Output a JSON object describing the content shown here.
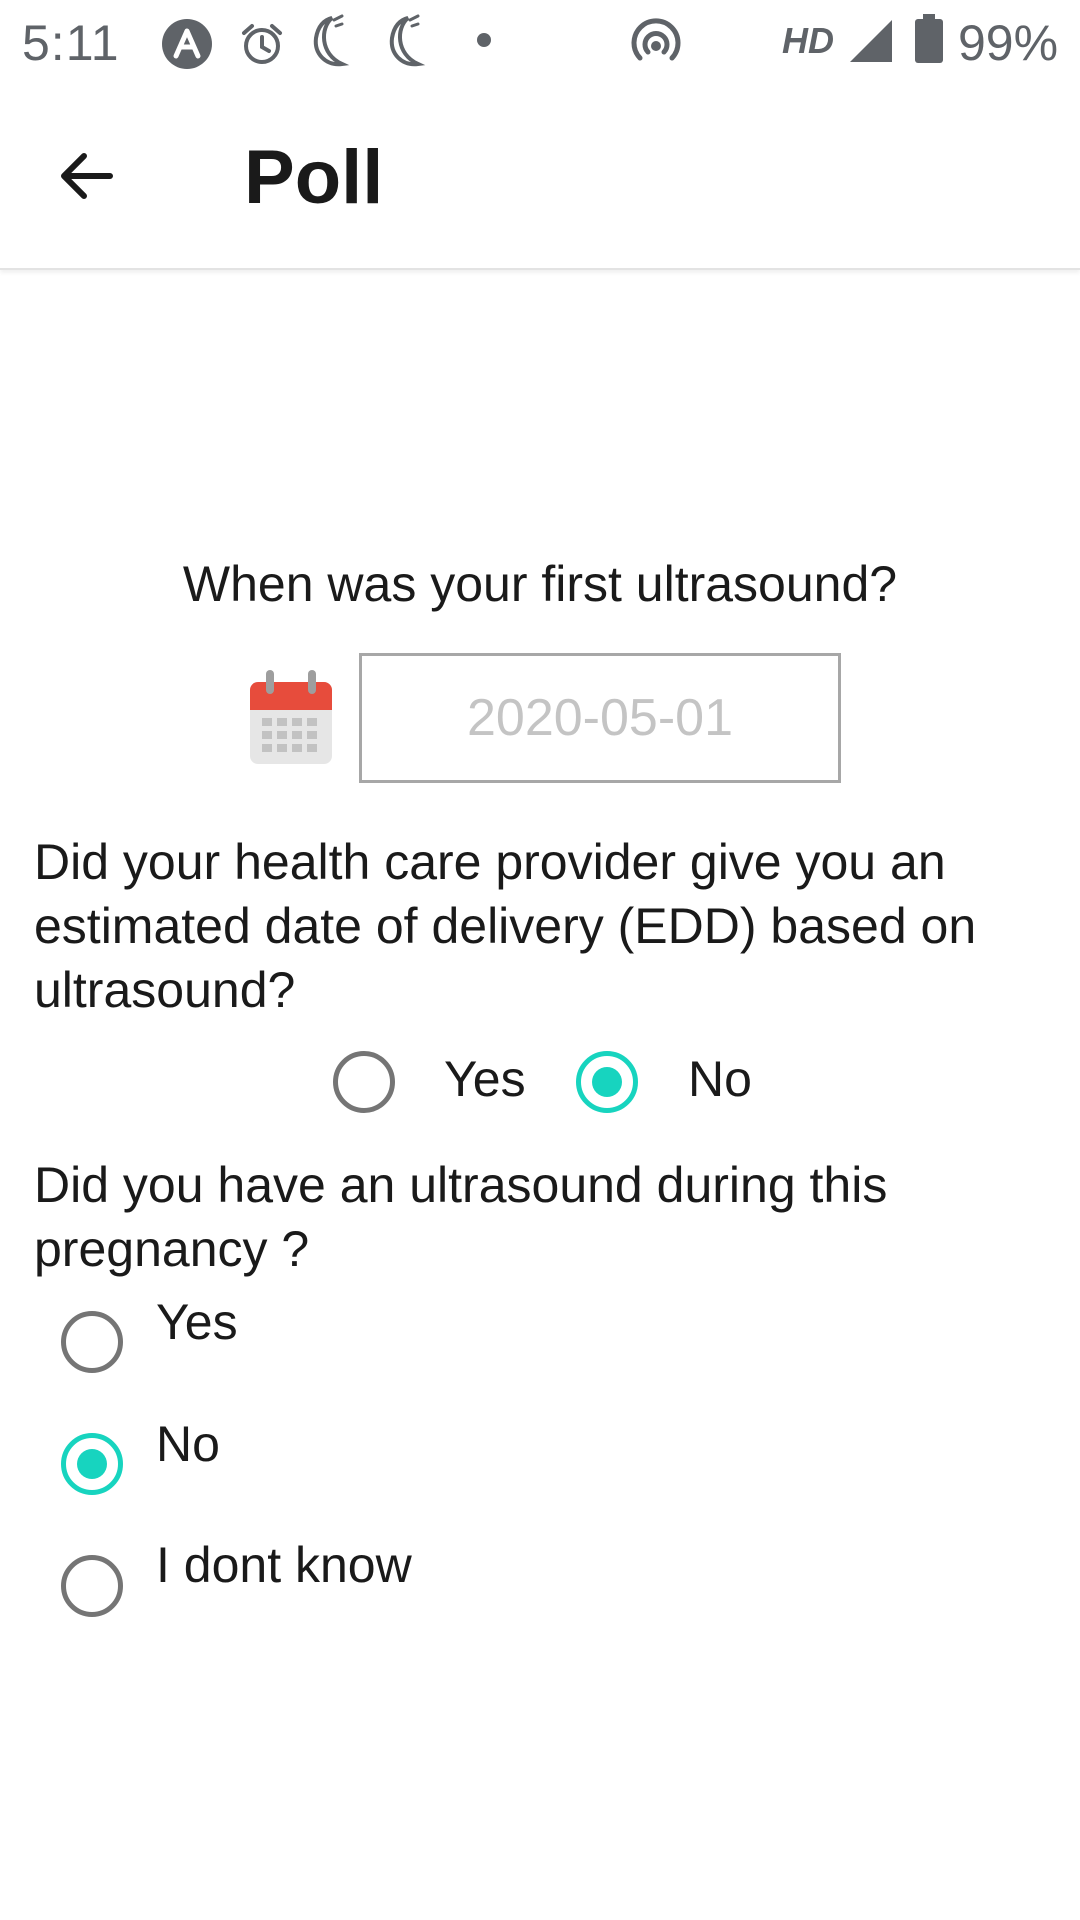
{
  "status_bar": {
    "time": "5:11",
    "network_type": "HD",
    "battery": "99%"
  },
  "app_bar": {
    "title": "Poll"
  },
  "question1": {
    "text": "When was your first ultrasound?",
    "date_placeholder": "2020-05-01"
  },
  "question2": {
    "text": " Did your health care provider give you an estimated date of delivery (EDD) based on ultrasound?",
    "options": [
      "Yes",
      "No"
    ],
    "selected": "No"
  },
  "question3": {
    "text": "Did you have an ultrasound during this pregnancy ?",
    "options": [
      "Yes",
      "No",
      "I dont know"
    ],
    "selected": "No"
  },
  "colors": {
    "accent": "#17d4bf",
    "radio_unchecked": "#757575",
    "calendar_red": "#e74c3c"
  }
}
